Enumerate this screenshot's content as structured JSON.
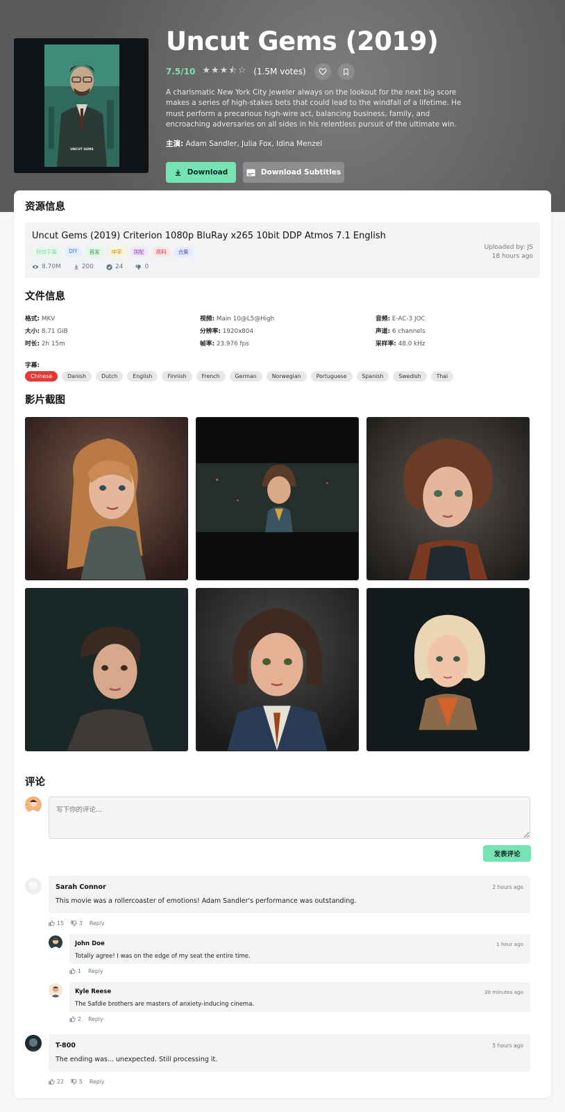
{
  "movie": {
    "title": "Uncut Gems (2019)",
    "rating": "7.5/10",
    "stars": "★★★⯪☆",
    "votes": "(1.5M votes)",
    "description": "A charismatic New York City jeweler always on the lookout for the next big score makes a series of high-stakes bets that could lead to the windfall of a lifetime. He must perform a precarious high-wire act, balancing business, family, and encroaching adversaries on all sides in his relentless pursuit of the ultimate win.",
    "cast_label": "主演:",
    "cast": "Adam Sandler, Julia Fox, Idina Menzel",
    "download_label": "Download",
    "subs_label": "Download Subtitles",
    "poster_text": "UNCUT GEMS"
  },
  "resource": {
    "section_title": "资源信息",
    "name": "Uncut Gems (2019) Criterion 1080p BluRay x265 10bit DDP Atmos 7.1 English",
    "tags": [
      {
        "label": "特效字幕",
        "bg": "#e7f7ee",
        "fg": "#8ad6ad"
      },
      {
        "label": "DIY",
        "bg": "#e5eefc",
        "fg": "#3b6fd1"
      },
      {
        "label": "首发",
        "bg": "#e3f6e8",
        "fg": "#2f9e55"
      },
      {
        "label": "中字",
        "bg": "#fdf3d4",
        "fg": "#b3830f"
      },
      {
        "label": "国配",
        "bg": "#f3e6fb",
        "fg": "#9342c2"
      },
      {
        "label": "高码",
        "bg": "#fde4e4",
        "fg": "#d14040"
      },
      {
        "label": "合集",
        "bg": "#e6e8fb",
        "fg": "#4b55c4"
      }
    ],
    "views": "8.70M",
    "downloads": "200",
    "likes": "24",
    "dislikes": "0",
    "uploaded_by": "Uploaded by: JS",
    "uploaded_time": "18 hours ago"
  },
  "file_info": {
    "section_title": "文件信息",
    "format_label": "格式:",
    "format": "MKV",
    "size_label": "大小:",
    "size": "8.71 GiB",
    "duration_label": "时长:",
    "duration": "2h 15m",
    "video_label": "视频:",
    "video": "Main 10@L5@High",
    "resolution_label": "分辨率:",
    "resolution": "1920x804",
    "framerate_label": "帧率:",
    "framerate": "23.976 fps",
    "audio_label": "音频:",
    "audio": "E-AC-3 JOC",
    "channels_label": "声道:",
    "channels": "6 channels",
    "samplerate_label": "采样率:",
    "samplerate": "48.0 kHz",
    "subtitles_label": "字幕:",
    "subtitles": [
      "Chinese",
      "Danish",
      "Dutch",
      "English",
      "Finnish",
      "French",
      "German",
      "Norwegian",
      "Portuguese",
      "Spanish",
      "Swedish",
      "Thai"
    ]
  },
  "screenshots": {
    "section_title": "影片截图"
  },
  "comments": {
    "section_title": "评论",
    "placeholder": "写下你的评论...",
    "post_label": "发表评论",
    "c1": {
      "name": "Sarah Connor",
      "time": "2 hours ago",
      "text": "This movie was a rollercoaster of emotions! Adam Sandler's performance was outstanding.",
      "likes": "15",
      "dislikes": "3",
      "reply": "Reply"
    },
    "r1": {
      "name": "John Doe",
      "time": "1 hour ago",
      "text": "Totally agree! I was on the edge of my seat the entire time.",
      "likes": "1",
      "reply": "Reply"
    },
    "r2": {
      "name": "Kyle Reese",
      "time": "30 minutes ago",
      "text": "The Safdie brothers are masters of anxiety-inducing cinema.",
      "likes": "2",
      "reply": "Reply"
    },
    "c2": {
      "name": "T-800",
      "time": "5 hours ago",
      "text": "The ending was... unexpected. Still processing it.",
      "likes": "22",
      "dislikes": "5",
      "reply": "Reply"
    }
  }
}
